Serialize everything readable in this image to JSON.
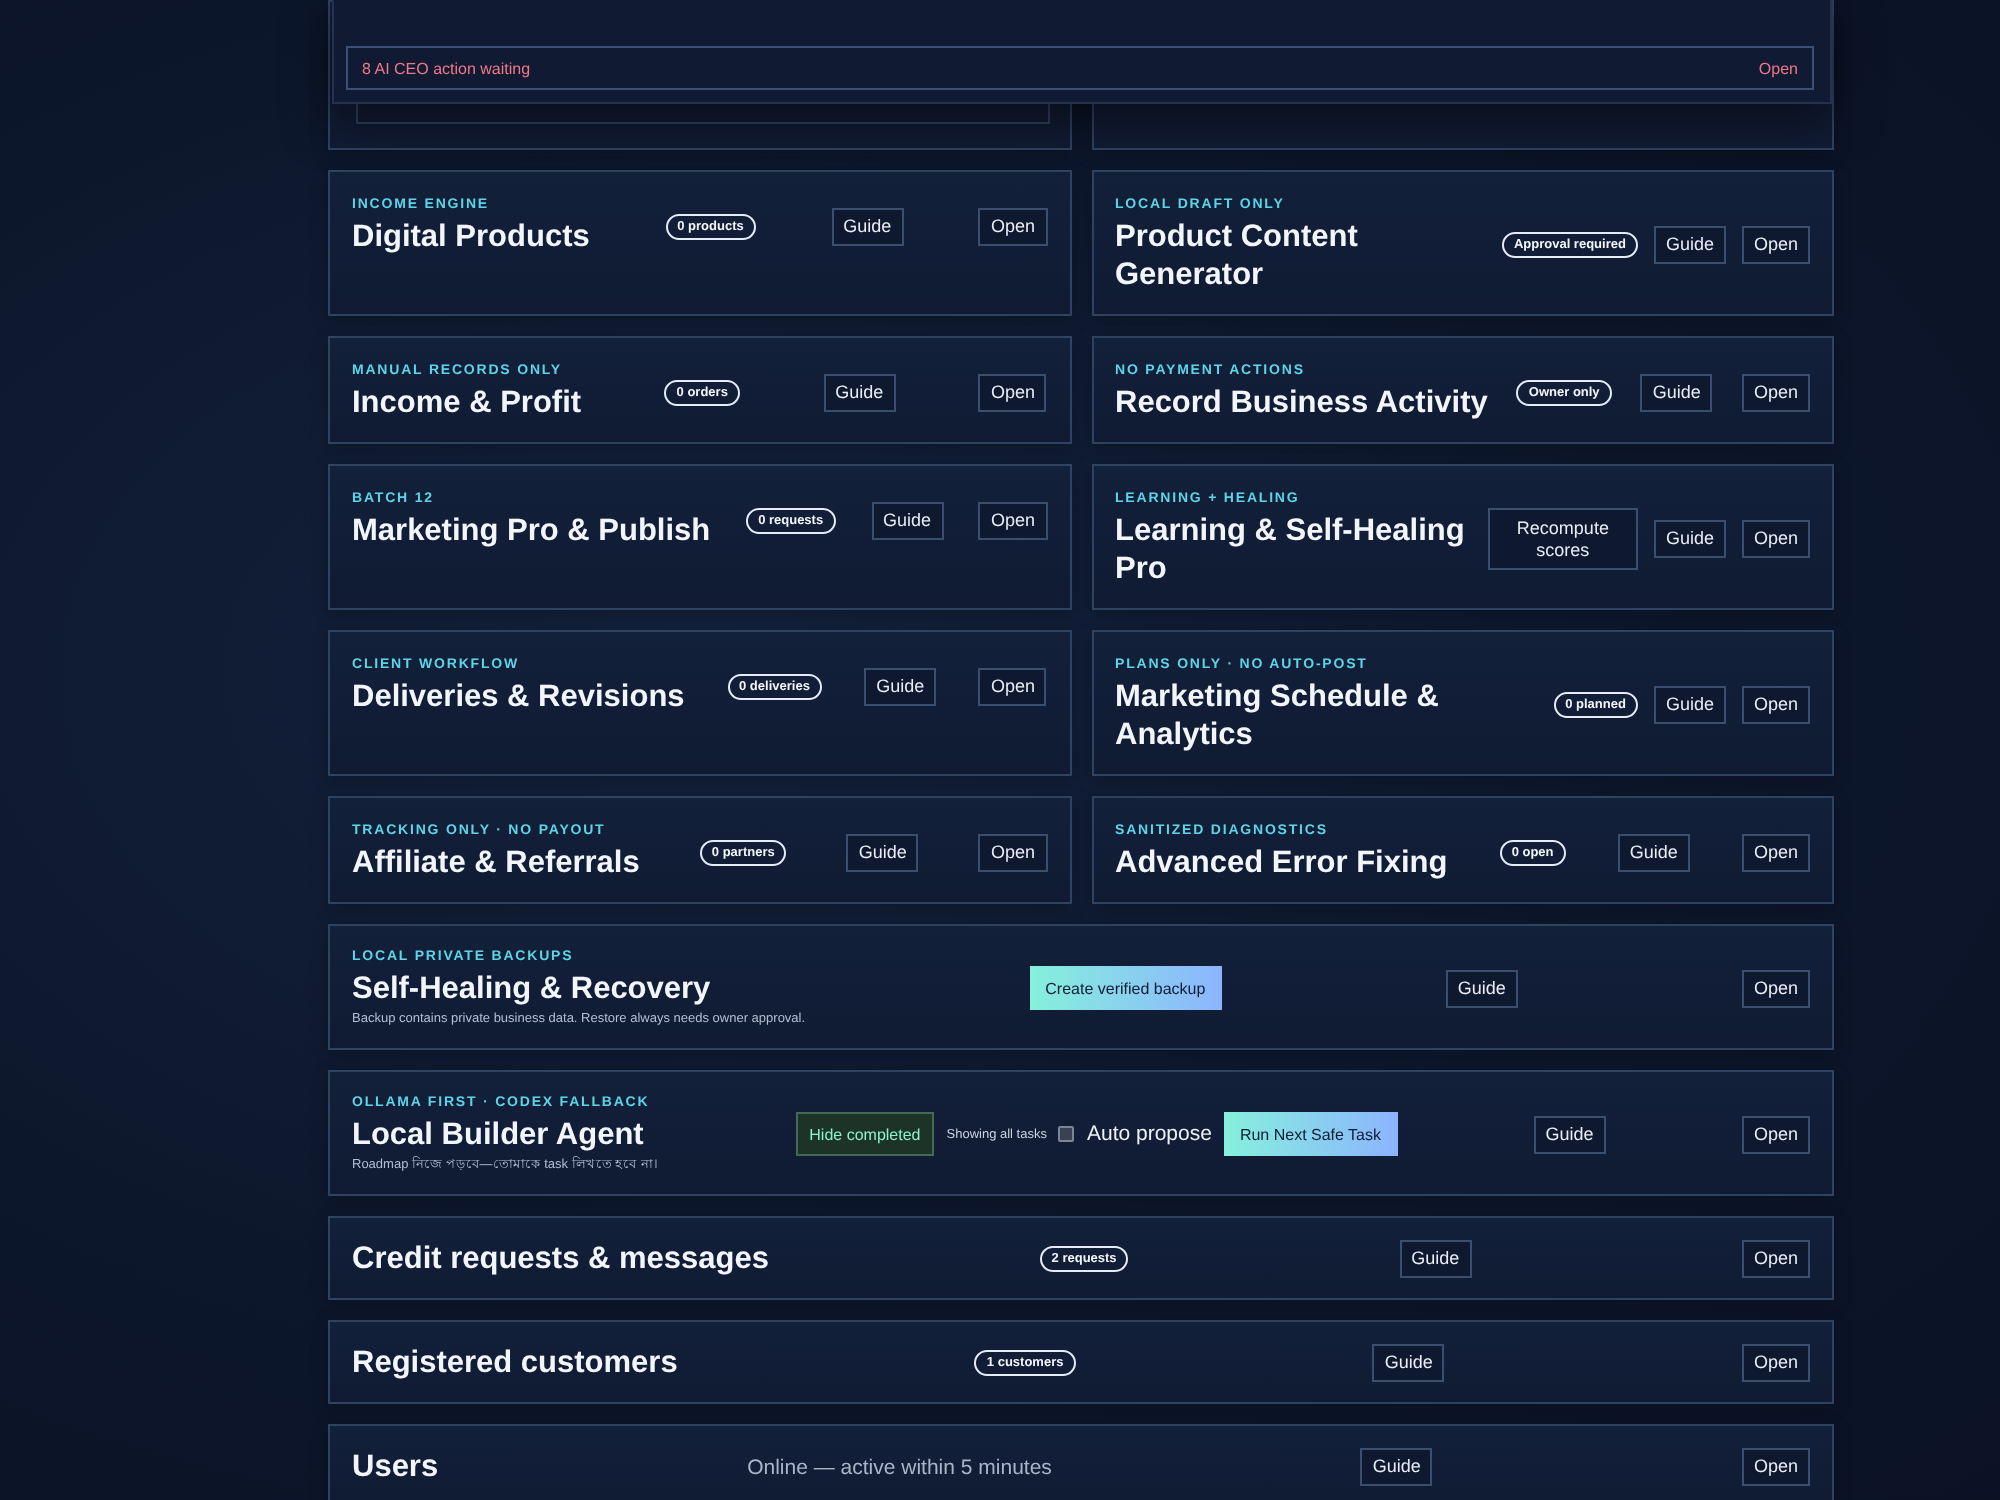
{
  "notifications": {
    "items": [
      {
        "text": "8 AI CEO action waiting",
        "action": "Open"
      }
    ]
  },
  "cards": [
    {
      "kicker": "INCOME ENGINE",
      "title": "Digital Products",
      "extras": [
        {
          "kind": "badge",
          "label": "0 products"
        }
      ],
      "guide": "Guide",
      "open": "Open"
    },
    {
      "kicker": "LOCAL DRAFT ONLY",
      "title": "Product Content Generator",
      "extras": [
        {
          "kind": "badge",
          "label": "Approval required"
        }
      ],
      "guide": "Guide",
      "open": "Open"
    },
    {
      "kicker": "MANUAL RECORDS ONLY",
      "title": "Income & Profit",
      "extras": [
        {
          "kind": "badge",
          "label": "0 orders"
        }
      ],
      "guide": "Guide",
      "open": "Open"
    },
    {
      "kicker": "NO PAYMENT ACTIONS",
      "title": "Record Business Activity",
      "extras": [
        {
          "kind": "badge",
          "label": "Owner only"
        }
      ],
      "guide": "Guide",
      "open": "Open"
    },
    {
      "kicker": "BATCH 12",
      "title": "Marketing Pro & Publish",
      "extras": [
        {
          "kind": "badge",
          "label": "0 requests"
        }
      ],
      "guide": "Guide",
      "open": "Open"
    },
    {
      "kicker": "LEARNING + HEALING",
      "title": "Learning & Self-Healing Pro",
      "extras": [
        {
          "kind": "outline",
          "label": "Recompute scores"
        }
      ],
      "guide": "Guide",
      "open": "Open"
    },
    {
      "kicker": "CLIENT WORKFLOW",
      "title": "Deliveries & Revisions",
      "extras": [
        {
          "kind": "badge",
          "label": "0 deliveries"
        }
      ],
      "guide": "Guide",
      "open": "Open"
    },
    {
      "kicker": "PLANS ONLY · NO AUTO-POST",
      "title": "Marketing Schedule & Analytics",
      "extras": [
        {
          "kind": "badge",
          "label": "0 planned"
        }
      ],
      "guide": "Guide",
      "open": "Open"
    },
    {
      "kicker": "TRACKING ONLY · NO PAYOUT",
      "title": "Affiliate & Referrals",
      "extras": [
        {
          "kind": "badge",
          "label": "0 partners"
        }
      ],
      "guide": "Guide",
      "open": "Open"
    },
    {
      "kicker": "SANITIZED DIAGNOSTICS",
      "title": "Advanced Error Fixing",
      "extras": [
        {
          "kind": "badge",
          "label": "0 open"
        }
      ],
      "guide": "Guide",
      "open": "Open"
    }
  ],
  "wide_cards": [
    {
      "kicker": "LOCAL PRIVATE BACKUPS",
      "title": "Self-Healing & Recovery",
      "note": "Backup contains private business data. Restore always needs owner approval.",
      "extras": [
        {
          "kind": "primary",
          "label": "Create verified backup"
        }
      ],
      "guide": "Guide",
      "open": "Open"
    },
    {
      "kicker": "OLLAMA FIRST · CODEX FALLBACK",
      "title": "Local Builder Agent",
      "note": "Roadmap নিজে পড়বে—তোমাকে task লিখতে হবে না।",
      "extras": [
        {
          "kind": "toggle",
          "label": "Hide completed"
        },
        {
          "kind": "caption",
          "label": "Showing all tasks"
        },
        {
          "kind": "checkbox",
          "label": "Auto propose",
          "checked": false
        },
        {
          "kind": "primary",
          "label": "Run Next Safe Task"
        }
      ],
      "guide": "Guide",
      "open": "Open"
    },
    {
      "title": "Credit requests & messages",
      "extras": [
        {
          "kind": "badge",
          "label": "2 requests"
        }
      ],
      "guide": "Guide",
      "open": "Open"
    },
    {
      "title": "Registered customers",
      "extras": [
        {
          "kind": "badge",
          "label": "1 customers"
        }
      ],
      "guide": "Guide",
      "open": "Open"
    },
    {
      "title": "Users",
      "extras": [
        {
          "kind": "status",
          "label": "Online — active within 5 minutes"
        }
      ],
      "guide": "Guide",
      "open": "Open"
    }
  ]
}
